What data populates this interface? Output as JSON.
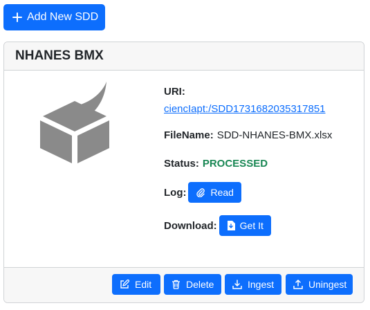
{
  "toolbar": {
    "add_label": "Add New SDD"
  },
  "card": {
    "title": "NHANES BMX",
    "uri_label": "URI:",
    "uri_value": "ciencIapt:/SDD1731682035317851",
    "filename_label": "FileName:",
    "filename_value": "SDD-NHANES-BMX.xlsx",
    "status_label": "Status:",
    "status_value": "PROCESSED",
    "log_label": "Log:",
    "read_label": "Read",
    "download_label": "Download:",
    "getit_label": "Get It"
  },
  "footer": {
    "edit_label": "Edit",
    "delete_label": "Delete",
    "ingest_label": "Ingest",
    "uningest_label": "Uningest"
  },
  "colors": {
    "primary": "#0d6efd",
    "success": "#198754",
    "logo_gray": "#8a8a8a"
  }
}
